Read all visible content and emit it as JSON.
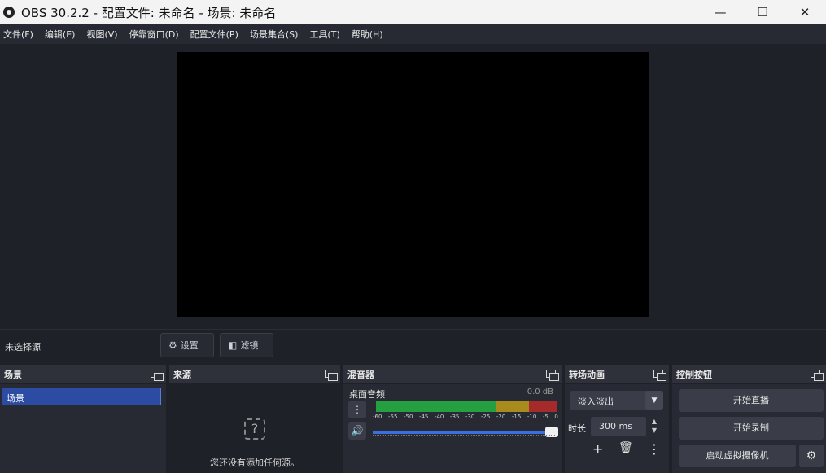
{
  "window": {
    "title": "OBS 30.2.2 - 配置文件: 未命名 - 场景: 未命名",
    "minimize": "—",
    "maximize": "☐",
    "close": "✕"
  },
  "menu": [
    "文件(F)",
    "编辑(E)",
    "视图(V)",
    "停靠窗口(D)",
    "配置文件(P)",
    "场景集合(S)",
    "工具(T)",
    "帮助(H)"
  ],
  "source_bar": {
    "no_source": "未选择源",
    "settings_label": "设置",
    "filters_label": "滤镜"
  },
  "scenes": {
    "header": "场景",
    "items": [
      "场景"
    ]
  },
  "sources": {
    "header": "来源",
    "empty_text": "您还没有添加任何源。",
    "empty_icon": "?"
  },
  "mixer": {
    "header": "混音器",
    "channel_name": "桌面音频",
    "channel_db": "0.0 dB",
    "scale": [
      "-60",
      "-55",
      "-50",
      "-45",
      "-40",
      "-35",
      "-30",
      "-25",
      "-20",
      "-15",
      "-10",
      "-5",
      "0"
    ],
    "volume": 1.0
  },
  "transitions": {
    "header": "转场动画",
    "selected": "淡入淡出",
    "duration_label": "时长",
    "duration_value": "300 ms",
    "add": "+",
    "remove": "🗑",
    "more": "⋮"
  },
  "controls": {
    "header": "控制按钮",
    "start_stream": "开始直播",
    "start_record": "开始录制",
    "start_virtualcam": "启动虚拟摄像机",
    "gear": "⚙"
  },
  "colors": {
    "accent": "#3b6fe0",
    "meter_green": "#24a040",
    "meter_yellow": "#a88a1e",
    "meter_red": "#a52a2a"
  }
}
